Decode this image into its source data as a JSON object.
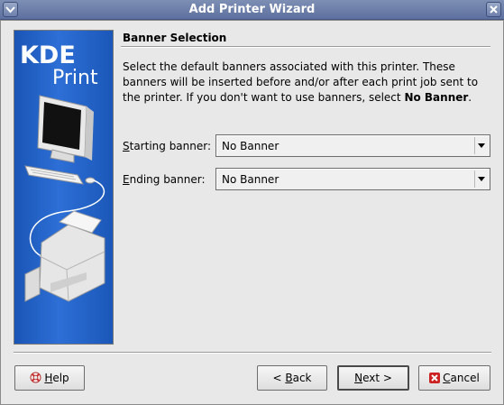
{
  "window": {
    "title": "Add Printer Wizard",
    "menu_icon": "chevron-down-icon",
    "close_icon": "close-icon"
  },
  "sidebar": {
    "logo_line1": "KDE",
    "logo_line2": "Print",
    "image_description_icon": "computer-printer-icon"
  },
  "page": {
    "section_title": "Banner Selection",
    "description_prefix": "Select the default banners associated with this printer. These banners will be inserted before and/or after each print job sent to the printer. If you don't want to use banners, select ",
    "description_bold": "No Banner",
    "description_suffix": "."
  },
  "fields": {
    "starting": {
      "label_mnemonic": "S",
      "label_rest": "tarting banner:",
      "value": "No Banner"
    },
    "ending": {
      "label_mnemonic": "E",
      "label_rest": "nding banner:",
      "value": "No Banner"
    }
  },
  "buttons": {
    "help": {
      "mnemonic": "H",
      "rest": "elp",
      "icon": "help-lifebuoy-icon"
    },
    "back": {
      "prefix": "< ",
      "mnemonic": "B",
      "rest": "ack"
    },
    "next": {
      "mnemonic": "N",
      "rest": "ext >"
    },
    "cancel": {
      "mnemonic": "C",
      "rest": "ancel",
      "icon": "cancel-x-icon"
    }
  },
  "colors": {
    "titlebar": "#6a7dab",
    "sidebar_blue": "#2d6fd6",
    "cancel_red": "#cc2222"
  }
}
